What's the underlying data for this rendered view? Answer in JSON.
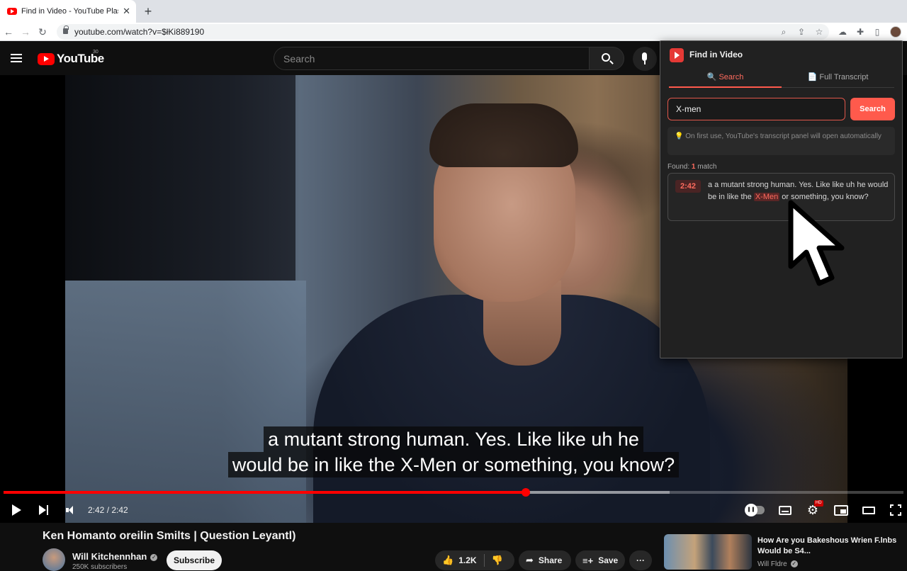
{
  "browser": {
    "tab_title": "Find in Video - YouTube Plasn",
    "tab_close": "✕",
    "new_tab": "+",
    "url": "youtube.com/watch?v=$łKi889190"
  },
  "youtube": {
    "logo_text": "YouTube",
    "logo_country": "30",
    "search_placeholder": "Search"
  },
  "video": {
    "captions": [
      "a mutant strong human. Yes. Like like uh he",
      "would be in like the X-Men or something, you know?"
    ],
    "time_display": "2:42 / 2:42",
    "progress_fraction": 0.58,
    "loaded_fraction": 0.74,
    "hd_badge": "HD"
  },
  "below_video": {
    "title": "Ken Homanto oreilin Smilts | Question Leyantl)",
    "channel_name": "Will Kitchennhan",
    "subscribers": "250K subscribers",
    "subscribe_label": "Subscribe",
    "likes": "1.2K",
    "share_label": "Share",
    "save_label": "Save",
    "more_label": "···",
    "recommended": {
      "title": "How Are you Bakeshous Wrien F.lnbs Would be S4...",
      "channel": "Will Fldre"
    }
  },
  "extension": {
    "title": "Find in Video",
    "tabs": [
      {
        "icon": "🔍",
        "label": "Search"
      },
      {
        "icon": "📄",
        "label": "Full Transcript"
      }
    ],
    "search_value": "X-men",
    "search_button": "Search",
    "tip_icon": "💡",
    "tip_text": "On first use, YouTube's transcript panel will open automatically",
    "found_prefix": "Found:",
    "found_count": "1",
    "found_suffix": "match",
    "results": [
      {
        "timestamp": "2:42",
        "text_before": "a a mutant strong human. Yes. Like like uh he would be in like the",
        "highlight": "X-Men",
        "text_after": "or something, you know?"
      }
    ]
  },
  "colors": {
    "accent": "#ff5a4c",
    "youtube_red": "#ff0000",
    "highlight_bg": "#5a2626"
  }
}
